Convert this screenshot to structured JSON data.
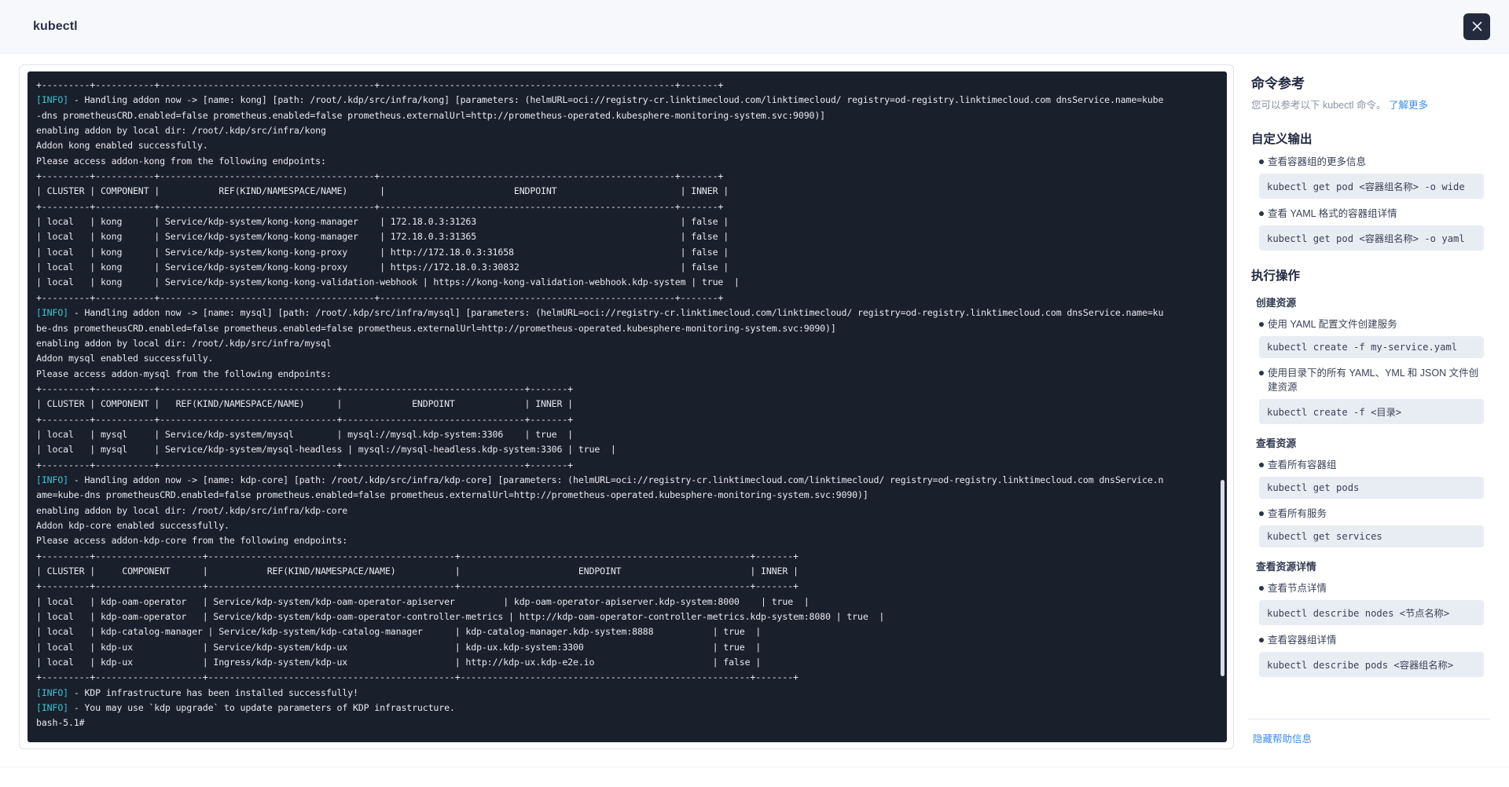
{
  "window": {
    "title": "kubectl",
    "close_icon": "close-icon"
  },
  "terminal": {
    "prompt": "bash-5.1#",
    "lines": [
      {
        "text": "+---------+-----------+----------------------------------------+-------------------------------------------------------+-------+"
      },
      {
        "info": true,
        "prefix": "[INFO]",
        "text": " - Handling addon now -> [name: kong] [path: /root/.kdp/src/infra/kong] [parameters: (helmURL=oci://registry-cr.linktimecloud.com/linktimecloud/ registry=od-registry.linktimecloud.com dnsService.name=kube"
      },
      {
        "text": "-dns prometheusCRD.enabled=false prometheus.enabled=false prometheus.externalUrl=http://prometheus-operated.kubesphere-monitoring-system.svc:9090)]"
      },
      {
        "text": "enabling addon by local dir: /root/.kdp/src/infra/kong"
      },
      {
        "text": "Addon kong enabled successfully."
      },
      {
        "text": "Please access addon-kong from the following endpoints:"
      },
      {
        "text": "+---------+-----------+----------------------------------------+-------------------------------------------------------+-------+"
      },
      {
        "text": "| CLUSTER | COMPONENT |           REF(KIND/NAMESPACE/NAME)      |                        ENDPOINT                       | INNER |"
      },
      {
        "text": "+---------+-----------+----------------------------------------+-------------------------------------------------------+-------+"
      },
      {
        "text": "| local   | kong      | Service/kdp-system/kong-kong-manager    | 172.18.0.3:31263                                      | false |"
      },
      {
        "text": "| local   | kong      | Service/kdp-system/kong-kong-manager    | 172.18.0.3:31365                                      | false |"
      },
      {
        "text": "| local   | kong      | Service/kdp-system/kong-kong-proxy      | http://172.18.0.3:31658                               | false |"
      },
      {
        "text": "| local   | kong      | Service/kdp-system/kong-kong-proxy      | https://172.18.0.3:30832                              | false |"
      },
      {
        "text": "| local   | kong      | Service/kdp-system/kong-kong-validation-webhook | https://kong-kong-validation-webhook.kdp-system | true  |"
      },
      {
        "text": "+---------+-----------+----------------------------------------+-------------------------------------------------------+-------+"
      },
      {
        "info": true,
        "prefix": "[INFO]",
        "text": " - Handling addon now -> [name: mysql] [path: /root/.kdp/src/infra/mysql] [parameters: (helmURL=oci://registry-cr.linktimecloud.com/linktimecloud/ registry=od-registry.linktimecloud.com dnsService.name=ku"
      },
      {
        "text": "be-dns prometheusCRD.enabled=false prometheus.enabled=false prometheus.externalUrl=http://prometheus-operated.kubesphere-monitoring-system.svc:9090)]"
      },
      {
        "text": "enabling addon by local dir: /root/.kdp/src/infra/mysql"
      },
      {
        "text": "Addon mysql enabled successfully."
      },
      {
        "text": "Please access addon-mysql from the following endpoints:"
      },
      {
        "text": "+---------+-----------+---------------------------------+----------------------------------+-------+"
      },
      {
        "text": "| CLUSTER | COMPONENT |   REF(KIND/NAMESPACE/NAME)      |             ENDPOINT             | INNER |"
      },
      {
        "text": "+---------+-----------+---------------------------------+----------------------------------+-------+"
      },
      {
        "text": "| local   | mysql     | Service/kdp-system/mysql        | mysql://mysql.kdp-system:3306    | true  |"
      },
      {
        "text": "| local   | mysql     | Service/kdp-system/mysql-headless | mysql://mysql-headless.kdp-system:3306 | true  |"
      },
      {
        "text": "+---------+-----------+---------------------------------+----------------------------------+-------+"
      },
      {
        "info": true,
        "prefix": "[INFO]",
        "text": " - Handling addon now -> [name: kdp-core] [path: /root/.kdp/src/infra/kdp-core] [parameters: (helmURL=oci://registry-cr.linktimecloud.com/linktimecloud/ registry=od-registry.linktimecloud.com dnsService.n"
      },
      {
        "text": "ame=kube-dns prometheusCRD.enabled=false prometheus.enabled=false prometheus.externalUrl=http://prometheus-operated.kubesphere-monitoring-system.svc:9090)]"
      },
      {
        "text": "enabling addon by local dir: /root/.kdp/src/infra/kdp-core"
      },
      {
        "text": "Addon kdp-core enabled successfully."
      },
      {
        "text": "Please access addon-kdp-core from the following endpoints:"
      },
      {
        "text": "+---------+--------------------+----------------------------------------------+------------------------------------------------------+-------+"
      },
      {
        "text": "| CLUSTER |     COMPONENT      |           REF(KIND/NAMESPACE/NAME)           |                      ENDPOINT                        | INNER |"
      },
      {
        "text": "+---------+--------------------+----------------------------------------------+------------------------------------------------------+-------+"
      },
      {
        "text": "| local   | kdp-oam-operator   | Service/kdp-system/kdp-oam-operator-apiserver         | kdp-oam-operator-apiserver.kdp-system:8000    | true  |"
      },
      {
        "text": "| local   | kdp-oam-operator   | Service/kdp-system/kdp-oam-operator-controller-metrics | http://kdp-oam-operator-controller-metrics.kdp-system:8080 | true  |"
      },
      {
        "text": "| local   | kdp-catalog-manager | Service/kdp-system/kdp-catalog-manager      | kdp-catalog-manager.kdp-system:8888           | true  |"
      },
      {
        "text": "| local   | kdp-ux             | Service/kdp-system/kdp-ux                    | kdp-ux.kdp-system:3300                        | true  |"
      },
      {
        "text": "| local   | kdp-ux             | Ingress/kdp-system/kdp-ux                    | http://kdp-ux.kdp-e2e.io                      | false |"
      },
      {
        "text": "+---------+--------------------+----------------------------------------------+------------------------------------------------------+-------+"
      },
      {
        "info": true,
        "prefix": "[INFO]",
        "text": " - KDP infrastructure has been installed successfully!"
      },
      {
        "info": true,
        "prefix": "[INFO]",
        "text": " - You may use `kdp upgrade` to update parameters of KDP infrastructure."
      },
      {
        "text": "bash-5.1#"
      }
    ]
  },
  "help": {
    "title": "命令参考",
    "description_prefix": "您可以参考以下 kubectl 命令。",
    "description_link": "了解更多",
    "hide_label": "隐藏帮助信息",
    "sections": [
      {
        "heading": "自定义输出",
        "groups": [
          {
            "subheading": "",
            "items": [
              {
                "label": "查看容器组的更多信息",
                "command": "kubectl get pod <容器组名称> -o wide"
              },
              {
                "label": "查看 YAML 格式的容器组详情",
                "command": "kubectl get pod <容器组名称> -o yaml"
              }
            ]
          }
        ]
      },
      {
        "heading": "执行操作",
        "groups": [
          {
            "subheading": "创建资源",
            "items": [
              {
                "label": "使用 YAML 配置文件创建服务",
                "command": "kubectl create -f my-service.yaml"
              },
              {
                "label": "使用目录下的所有 YAML、YML 和 JSON 文件创建资源",
                "command": "kubectl create -f <目录>"
              }
            ]
          },
          {
            "subheading": "查看资源",
            "items": [
              {
                "label": "查看所有容器组",
                "command": "kubectl get pods"
              },
              {
                "label": "查看所有服务",
                "command": "kubectl get services"
              }
            ]
          },
          {
            "subheading": "查看资源详情",
            "items": [
              {
                "label": "查看节点详情",
                "command": "kubectl describe nodes <节点名称>"
              },
              {
                "label": "查看容器组详情",
                "command": "kubectl describe pods <容器组名称>"
              }
            ]
          }
        ]
      }
    ]
  },
  "colors": {
    "terminal_bg": "#1a1f2c",
    "info_cyan": "#35c6cf",
    "link_blue": "#3c8cf5",
    "titlebar_bg": "#f7f8fc",
    "close_bg": "#242b3d",
    "command_bg": "#e8ecf3"
  }
}
